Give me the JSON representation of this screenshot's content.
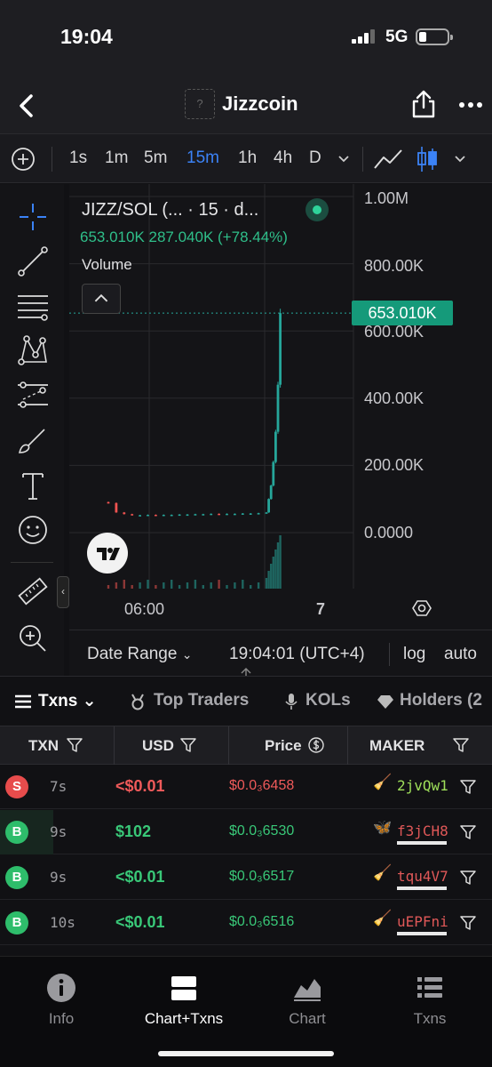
{
  "status": {
    "time": "19:04",
    "network": "5G"
  },
  "header": {
    "logo_placeholder": "?",
    "token_name": "Jizzcoin"
  },
  "timeframes": {
    "items": [
      "1s",
      "1m",
      "5m",
      "15m",
      "1h",
      "4h",
      "D"
    ],
    "active": "15m"
  },
  "chart": {
    "pair_title": "JIZZ/SOL (...  · 15 · d...",
    "legend_values": "653.010K  287.040K (+78.44%)",
    "volume_label": "Volume",
    "current_price_label": "653.010K",
    "y_ticks": [
      "1.00M",
      "800.00K",
      "600.00K",
      "400.00K",
      "200.00K",
      "0.0000"
    ],
    "x_ticks": [
      "06:00",
      "7"
    ],
    "colors": {
      "up": "#26a69a",
      "down": "#ef5350",
      "grid": "#2a2a2e"
    }
  },
  "chart_data": {
    "type": "candlestick",
    "title": "JIZZ/SOL (... · 15 · d...",
    "x_ticks": [
      "06:00",
      "7"
    ],
    "ylim": [
      0,
      1000000
    ],
    "last_price": 653010,
    "change": 287040,
    "change_pct": 78.44,
    "series": [
      {
        "values": [
          88000,
          60000,
          55000,
          52000,
          52000,
          53000,
          52000,
          53000,
          53000,
          54000,
          54000,
          55000,
          55000,
          56000,
          55000,
          56000,
          56000,
          57000,
          57000,
          58000,
          60000,
          100000,
          140000,
          210000,
          300000,
          440000,
          653010
        ]
      }
    ]
  },
  "chart_footer": {
    "date_range": "Date Range",
    "time": "19:04:01 (UTC+4)",
    "log": "log",
    "auto": "auto"
  },
  "tabs": {
    "txns": "Txns",
    "top_traders": "Top Traders",
    "kols": "KOLs",
    "holders": "Holders (2"
  },
  "table": {
    "headers": {
      "txn": "TXN",
      "usd": "USD",
      "price": "Price",
      "maker": "MAKER"
    },
    "rows": [
      {
        "type": "S",
        "side": "sell",
        "age": "7s",
        "usd": "<$0.01",
        "price": "$0.0₃6458",
        "maker": "2jvQw1",
        "emoji": "🧹"
      },
      {
        "type": "B",
        "side": "buy",
        "age": "9s",
        "usd": "$102",
        "price": "$0.0₃6530",
        "maker": "f3jCH8",
        "emoji": "🦋"
      },
      {
        "type": "B",
        "side": "buy",
        "age": "9s",
        "usd": "<$0.01",
        "price": "$0.0₃6517",
        "maker": "tqu4V7",
        "emoji": "🧹"
      },
      {
        "type": "B",
        "side": "buy",
        "age": "10s",
        "usd": "<$0.01",
        "price": "$0.0₃6516",
        "maker": "uEPFni",
        "emoji": "🧹"
      }
    ]
  },
  "nav": {
    "items": [
      {
        "label": "Info"
      },
      {
        "label": "Chart+Txns"
      },
      {
        "label": "Chart"
      },
      {
        "label": "Txns"
      }
    ]
  }
}
